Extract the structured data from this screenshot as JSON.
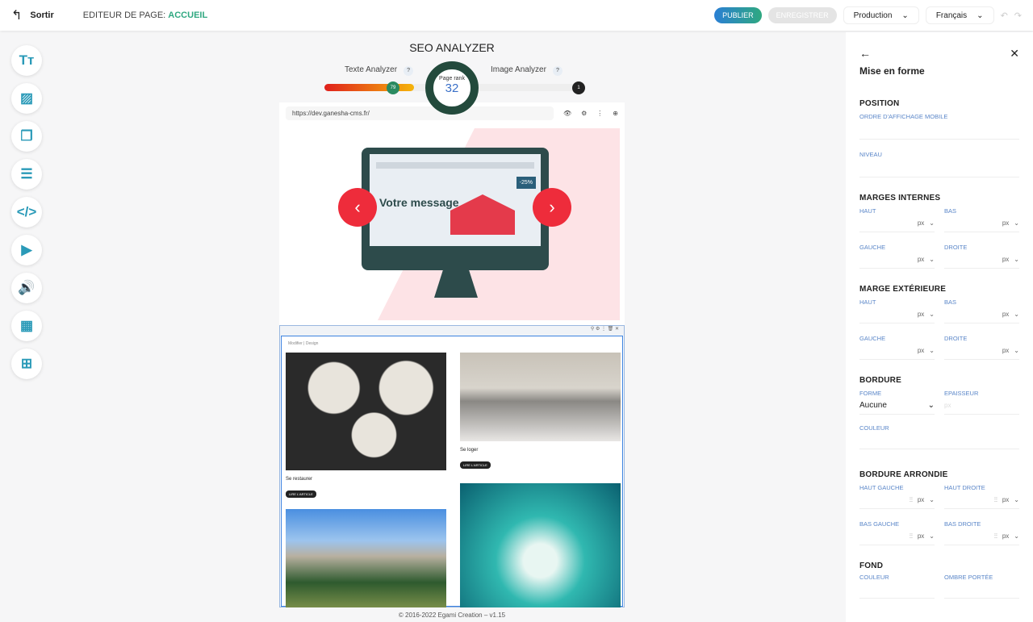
{
  "topbar": {
    "exit_label": "Sortir",
    "editor_label": "EDITEUR DE PAGE:",
    "page_name": "ACCUEIL",
    "publish": "PUBLIER",
    "save": "ENREGISTRER",
    "environment": "Production",
    "language": "Français"
  },
  "tools": [
    {
      "icon": "text-icon",
      "glyph": "Tт"
    },
    {
      "icon": "image-icon",
      "glyph": "▨"
    },
    {
      "icon": "gallery-icon",
      "glyph": "❐"
    },
    {
      "icon": "list-icon",
      "glyph": "☰"
    },
    {
      "icon": "code-icon",
      "glyph": "</>"
    },
    {
      "icon": "play-icon",
      "glyph": "▶"
    },
    {
      "icon": "audio-icon",
      "glyph": "🔊"
    },
    {
      "icon": "map-icon",
      "glyph": "▦"
    },
    {
      "icon": "widgets-add-icon",
      "glyph": "⊞"
    }
  ],
  "seo": {
    "title": "SEO ANALYZER",
    "text_label": "Texte Analyzer",
    "text_score": "79",
    "text_progress": 79,
    "image_label": "Image Analyzer",
    "image_score": "1",
    "rank_label": "Page rank",
    "rank_value": "32",
    "help": "?"
  },
  "preview": {
    "url": "https://dev.ganesha-cms.fr/",
    "hero_message": "Votre message",
    "promo": "-25%",
    "crumb": "Modifier | Design",
    "cards": [
      {
        "title": "Se restaurer",
        "button": "LIRE L'ARTICLE"
      },
      {
        "title": "Se loger",
        "button": "LIRE L'ARTICLE"
      }
    ]
  },
  "footer": "© 2016-2022 Egami Creation  –  v1.15",
  "panel": {
    "title": "Mise en forme",
    "position": {
      "title": "POSITION",
      "mobile": "ORDRE D'AFFICHAGE MOBILE",
      "level": "NIVEAU"
    },
    "padding": {
      "title": "MARGES INTERNES"
    },
    "margin": {
      "title": "MARGE EXTÉRIEURE"
    },
    "labels": {
      "top": "HAUT",
      "bottom": "BAS",
      "left": "GAUCHE",
      "right": "DROITE",
      "unit": "px"
    },
    "border": {
      "title": "BORDURE",
      "shape": "FORME",
      "shape_value": "Aucune",
      "thickness": "EPAISSEUR",
      "thickness_ph": "px",
      "color": "COULEUR"
    },
    "radius": {
      "title": "BORDURE ARRONDIE",
      "tl": "HAUT GAUCHE",
      "tr": "HAUT DROITE",
      "bl": "BAS GAUCHE",
      "br": "BAS DROITE"
    },
    "background": {
      "title": "FOND",
      "color": "COULEUR",
      "shadow": "OMBRE PORTÉE"
    }
  },
  "colors": {
    "accent": "#2fa880",
    "publish": "#2a7fd4",
    "arrow": "#ee2c3b",
    "rank_ring": "#234a3c"
  }
}
